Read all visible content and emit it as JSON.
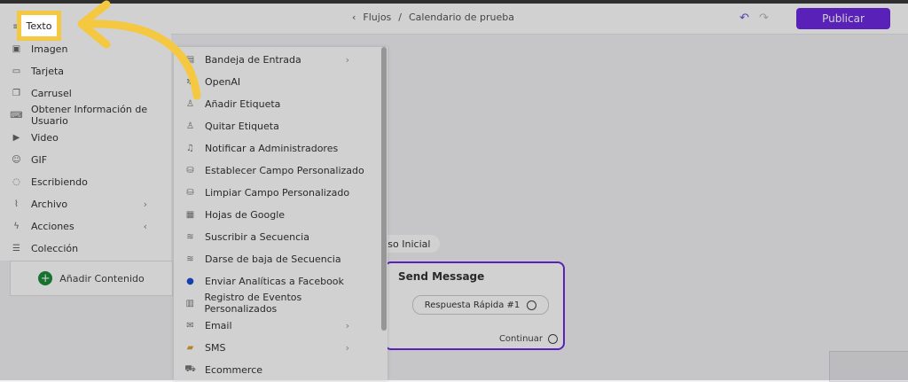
{
  "header": {
    "breadcrumb_flows": "Flujos",
    "breadcrumb_sep": "/",
    "breadcrumb_current": "Calendario de prueba",
    "publish_label": "Publicar"
  },
  "highlight_label": "Texto",
  "left_menu": [
    {
      "label": "Imagen",
      "icon": "image-icon"
    },
    {
      "label": "Tarjeta",
      "icon": "card-icon"
    },
    {
      "label": "Carrusel",
      "icon": "carousel-icon"
    },
    {
      "label": "Obtener Información de Usuario",
      "icon": "keyboard-icon"
    },
    {
      "label": "Video",
      "icon": "video-icon"
    },
    {
      "label": "GIF",
      "icon": "gif-icon"
    },
    {
      "label": "Escribiendo",
      "icon": "typing-icon"
    },
    {
      "label": "Archivo",
      "icon": "paperclip-icon"
    },
    {
      "label": "Acciones",
      "icon": "lightning-icon"
    },
    {
      "label": "Colección",
      "icon": "list-icon"
    }
  ],
  "add_content_label": "Añadir Contenido",
  "sub_menu": [
    {
      "label": "Bandeja de Entrada",
      "icon": "inbox-icon"
    },
    {
      "label": "OpenAI",
      "icon": "openai-icon"
    },
    {
      "label": "Añadir Etiqueta",
      "icon": "user-tag-icon"
    },
    {
      "label": "Quitar Etiqueta",
      "icon": "user-tag-icon"
    },
    {
      "label": "Notificar a Administradores",
      "icon": "bell-icon"
    },
    {
      "label": "Establecer Campo Personalizado",
      "icon": "database-icon"
    },
    {
      "label": "Limpiar Campo Personalizado",
      "icon": "database-icon"
    },
    {
      "label": "Hojas de Google",
      "icon": "sheet-icon"
    },
    {
      "label": "Suscribir a Secuencia",
      "icon": "sequence-icon"
    },
    {
      "label": "Darse de baja de Secuencia",
      "icon": "sequence-icon"
    },
    {
      "label": "Enviar Analíticas a Facebook",
      "icon": "facebook-icon"
    },
    {
      "label": "Registro de Eventos Personalizados",
      "icon": "chart-icon"
    },
    {
      "label": "Email",
      "icon": "mail-icon"
    },
    {
      "label": "SMS",
      "icon": "sms-icon"
    },
    {
      "label": "Ecommerce",
      "icon": "cart-icon"
    }
  ],
  "canvas": {
    "start_pill": "aso Inicial",
    "node_title": "Send Message",
    "quick_reply": "Respuesta Rápida #1",
    "continue_label": "Continuar"
  },
  "colors": {
    "accent": "#6d29e0",
    "highlight": "#f5c842",
    "add_green": "#1d8c3a"
  }
}
